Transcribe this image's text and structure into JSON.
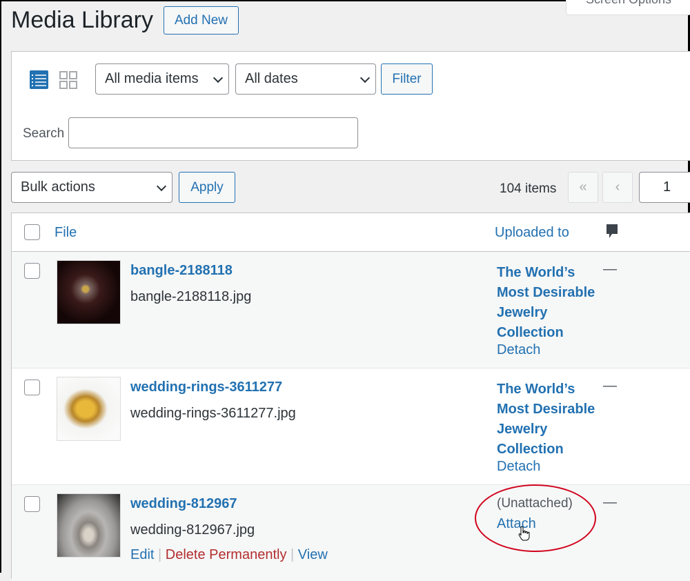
{
  "header": {
    "title": "Media Library",
    "add_new": "Add New",
    "screen_options": "Screen Options"
  },
  "filters": {
    "view_list_icon": "list-view-icon",
    "view_grid_icon": "grid-view-icon",
    "media_type": "All media items",
    "dates": "All dates",
    "filter_label": "Filter",
    "search_label": "Search",
    "search_value": ""
  },
  "bulk": {
    "action": "Bulk actions",
    "apply": "Apply"
  },
  "pagination": {
    "count": "104 items",
    "first": "«",
    "prev": "‹",
    "page": "1"
  },
  "table": {
    "col_file": "File",
    "col_uploaded": "Uploaded to",
    "col_comments_icon": "comment-icon",
    "rows": [
      {
        "title": "bangle-2188118",
        "filename": "bangle-2188118.jpg",
        "uploaded": [
          "The World’s",
          "Most Desirable",
          "Jewelry",
          "Collection"
        ],
        "action": "Detach",
        "comments": "—"
      },
      {
        "title": "wedding-rings-3611277",
        "filename": "wedding-rings-3611277.jpg",
        "uploaded": [
          "The World’s",
          "Most Desirable",
          "Jewelry",
          "Collection"
        ],
        "action": "Detach",
        "comments": "—"
      },
      {
        "title": "wedding-812967",
        "filename": "wedding-812967.jpg",
        "unattached": "(Unattached)",
        "action": "Attach",
        "comments": "—",
        "row_actions": {
          "edit": "Edit",
          "delete": "Delete Permanently",
          "view": "View"
        }
      }
    ]
  },
  "colors": {
    "accent": "#2271b1",
    "delete": "#b32d2e",
    "annotation": "#d0021b"
  }
}
